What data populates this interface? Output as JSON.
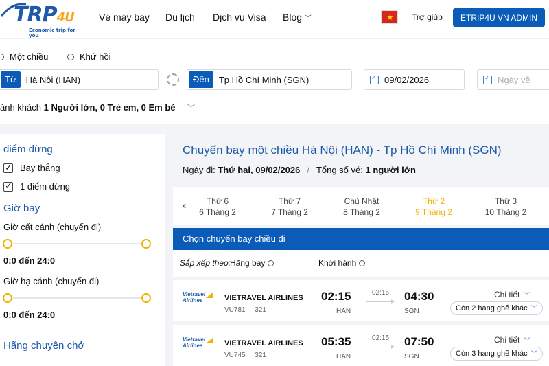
{
  "brand": {
    "logo_text": "TRP",
    "logo_suffix": "4U",
    "tagline": "Economic trip for you"
  },
  "nav": {
    "items": [
      "Vé máy bay",
      "Du lịch",
      "Dịch vụ Visa",
      "Blog"
    ],
    "help": "Trợ giúp",
    "admin": "ETRIP4U VN ADMIN"
  },
  "search": {
    "oneway": "Một chiều",
    "roundtrip": "Khứ hồi",
    "from_tag": "Từ",
    "from_value": "Hà Nội (HAN)",
    "to_tag": "Đến",
    "to_value": "Tp Hồ Chí Minh (SGN)",
    "depart_date": "09/02/2026",
    "return_placeholder": "Ngày về",
    "pax_label": "ành khách",
    "pax_value": "1 Người lớn, 0 Trẻ em, 0 Em bé"
  },
  "sidebar": {
    "stops_title": "điểm dừng",
    "stops": [
      "Bay thẳng",
      "1 điểm dừng"
    ],
    "time_title": "Giờ bay",
    "depart_label": "Giờ cất cánh (chuyến đi)",
    "depart_range": "0:0 đến 24:0",
    "arrive_label": "Giờ hạ cánh (chuyến đi)",
    "arrive_range": "0:0 đến 24:0",
    "airline_title": "Hãng chuyên chở"
  },
  "main": {
    "title": "Chuyến bay một chiều Hà Nội (HAN) - Tp Hồ Chí Minh (SGN)",
    "date_label": "Ngày đi:",
    "date_value": "Thứ hai, 09/02/2026",
    "tickets_label": "Tổng số vé:",
    "tickets_value": "1 người lớn",
    "days": [
      {
        "name": "Thứ 6",
        "date": "6 Tháng 2"
      },
      {
        "name": "Thứ 7",
        "date": "7 Tháng 2"
      },
      {
        "name": "Chủ Nhật",
        "date": "8 Tháng 2"
      },
      {
        "name": "Thứ 2",
        "date": "9 Tháng 2"
      },
      {
        "name": "Thứ 3",
        "date": "10 Tháng 2"
      }
    ],
    "choose_label": "Chọn chuyến bay chiều đi",
    "sort_label": "Sắp xếp theo:",
    "sort_airline": "Hãng bay",
    "sort_depart": "Khởi hành"
  },
  "flights": [
    {
      "airline": "VIETRAVEL AIRLINES",
      "code": "VU781",
      "aircraft": "321",
      "dep": "02:15",
      "dep_code": "HAN",
      "duration": "02:15",
      "arr": "04:30",
      "arr_code": "SGN",
      "detail": "Chi tiết",
      "more": "Còn 2 hạng ghế khác"
    },
    {
      "airline": "VIETRAVEL AIRLINES",
      "code": "VU745",
      "aircraft": "321",
      "dep": "05:35",
      "dep_code": "HAN",
      "duration": "02:15",
      "arr": "07:50",
      "arr_code": "SGN",
      "detail": "Chi tiết",
      "more": "Còn 3 hạng ghế khác"
    }
  ],
  "airline_logo_text": "Vietravel Airlines",
  "colors": {
    "primary": "#0b5cb8",
    "title_blue": "#1e5aa8",
    "accent": "#f0b400"
  }
}
